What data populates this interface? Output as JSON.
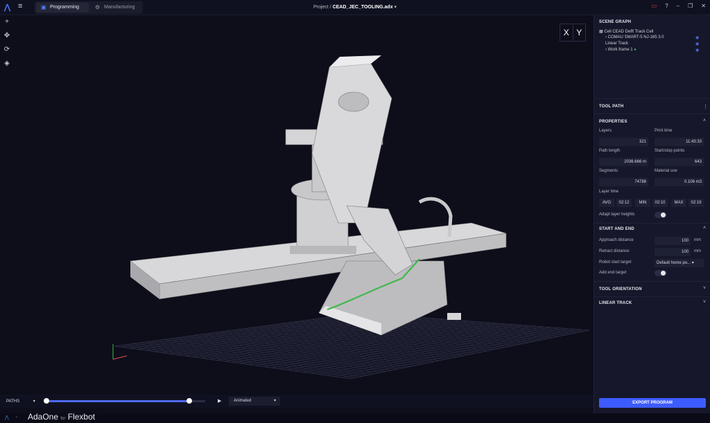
{
  "topbar": {
    "tabs": [
      {
        "label": "Programming",
        "icon": "layers-icon"
      },
      {
        "label": "Manufacturing",
        "icon": "gear-icon"
      }
    ],
    "title_prefix": "Project /",
    "title_file": "CEAD_JEC_TOOLING.adx",
    "accent": "#4f7bff"
  },
  "viewcube": {
    "x": "X",
    "y": "Y"
  },
  "scene_graph": {
    "heading": "SCENE GRAPH",
    "items": [
      {
        "label": "Cell CEAD Delft Track Cell"
      },
      {
        "label": "COMAU SMART-5 NJ-165 3.0"
      },
      {
        "label": "Linear Track"
      },
      {
        "label": "Work frame 1"
      }
    ]
  },
  "tool_path": {
    "heading": "TOOL PATH"
  },
  "properties": {
    "heading": "PROPERTIES",
    "layers_label": "Layers",
    "layers": "321",
    "print_time_label": "Print time",
    "print_time": "11:43:33",
    "path_length_label": "Path length",
    "path_length": "2036.666 m",
    "startstop_label": "Start/stop points",
    "startstop": "643",
    "segments_label": "Segments",
    "segments": "74788",
    "material_label": "Material use",
    "material": "0.106 m3",
    "layer_time_label": "Layer time",
    "avg_label": "AVG",
    "avg": "02:12",
    "min_label": "MIN",
    "min": "02:10",
    "max_label": "MAX",
    "max": "02:19",
    "adapt_label": "Adapt layer heights"
  },
  "start_end": {
    "heading": "START AND END",
    "approach_label": "Approach distance",
    "approach": "100",
    "unit": "mm",
    "retract_label": "Retract distance",
    "retract": "100",
    "robot_start_label": "Robot start target",
    "robot_start": "Default home po...",
    "add_end_label": "Add end target"
  },
  "tool_orientation": {
    "heading": "TOOL ORIENTATION"
  },
  "linear_track": {
    "heading": "LINEAR TRACK"
  },
  "export_label": "EXPORT PROGRAM",
  "bottombar": {
    "paths": "PATHS",
    "mode": "Animated",
    "progress": 0.9
  },
  "footer": {
    "brand_a": "AdaOne",
    "brand_for": "for",
    "brand_b": "Flexbot"
  }
}
